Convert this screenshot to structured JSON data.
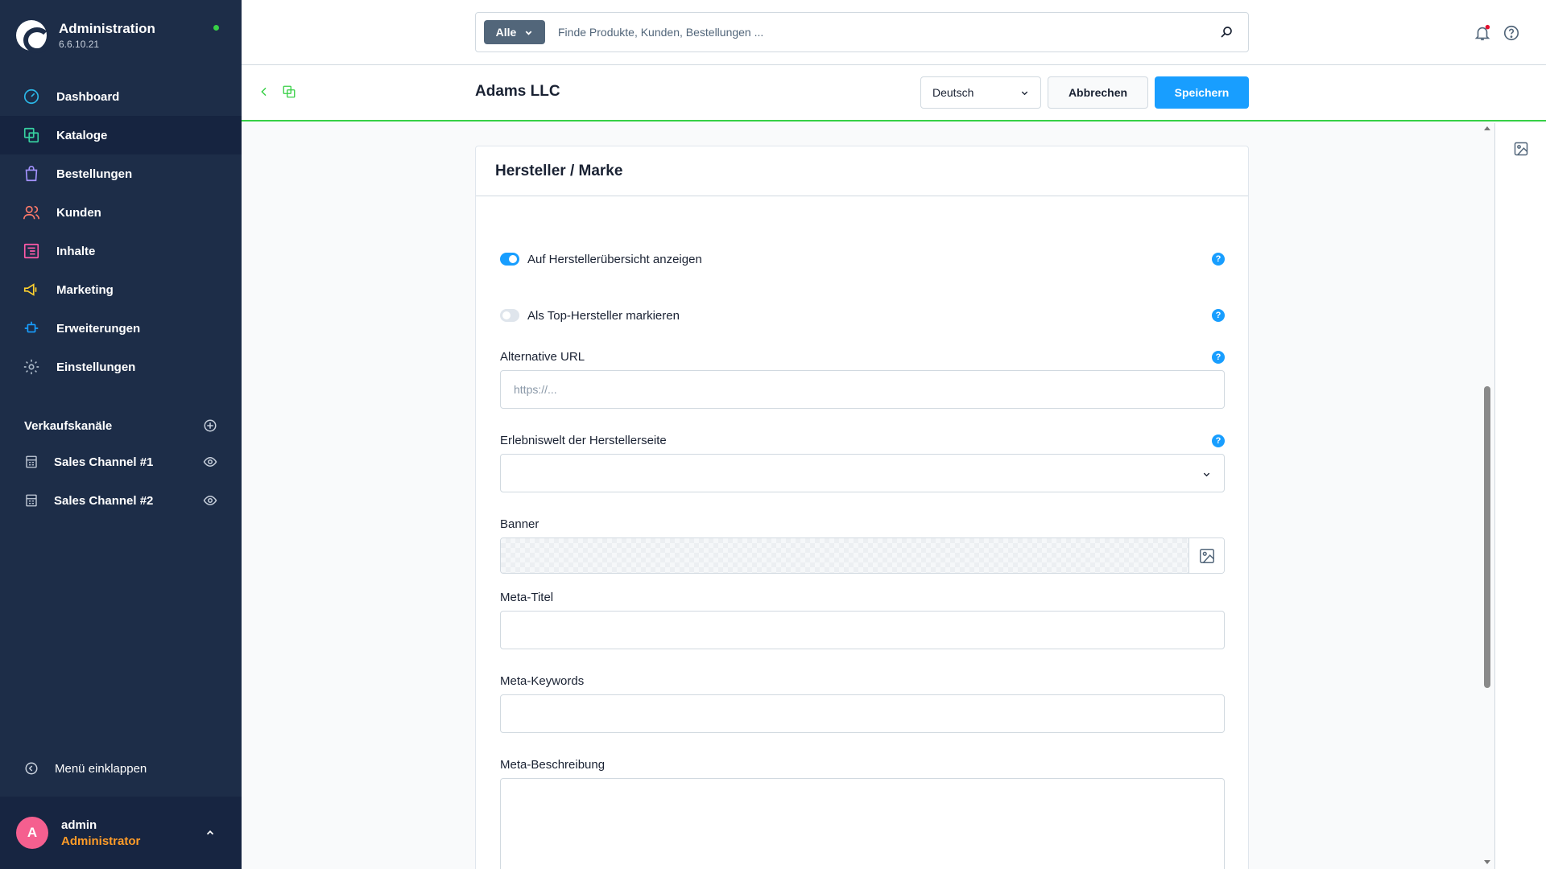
{
  "app": {
    "title": "Administration",
    "version": "6.6.10.21"
  },
  "nav": {
    "items": [
      {
        "label": "Dashboard"
      },
      {
        "label": "Kataloge"
      },
      {
        "label": "Bestellungen"
      },
      {
        "label": "Kunden"
      },
      {
        "label": "Inhalte"
      },
      {
        "label": "Marketing"
      },
      {
        "label": "Erweiterungen"
      },
      {
        "label": "Einstellungen"
      }
    ]
  },
  "sales_channels": {
    "title": "Verkaufskanäle",
    "items": [
      {
        "label": "Sales Channel #1"
      },
      {
        "label": "Sales Channel #2"
      }
    ]
  },
  "sidebar": {
    "collapse_label": "Menü einklappen"
  },
  "user": {
    "initial": "A",
    "name": "admin",
    "role": "Administrator"
  },
  "search": {
    "type_label": "Alle",
    "placeholder": "Finde Produkte, Kunden, Bestellungen ..."
  },
  "smartbar": {
    "title": "Adams LLC",
    "language": "Deutsch",
    "cancel_label": "Abbrechen",
    "save_label": "Speichern"
  },
  "card": {
    "title": "Hersteller / Marke",
    "toggle_overview_label": "Auf Herstellerübersicht anzeigen",
    "toggle_top_label": "Als Top-Hersteller markieren",
    "alt_url_label": "Alternative URL",
    "alt_url_placeholder": "https://...",
    "experience_label": "Erlebniswelt der Herstellerseite",
    "banner_label": "Banner",
    "meta_title_label": "Meta-Titel",
    "meta_keywords_label": "Meta-Keywords",
    "meta_description_label": "Meta-Beschreibung",
    "help_glyph": "?"
  },
  "colors": {
    "sidebar_bg": "#1d2d48",
    "primary": "#189eff",
    "accent_green": "#37d046",
    "user_role": "#ff9c28",
    "avatar": "#f55f8f"
  },
  "icons": {
    "nav": [
      "dashboard-icon",
      "catalog-icon",
      "orders-icon",
      "customers-icon",
      "content-icon",
      "marketing-icon",
      "extensions-icon",
      "settings-icon"
    ]
  }
}
